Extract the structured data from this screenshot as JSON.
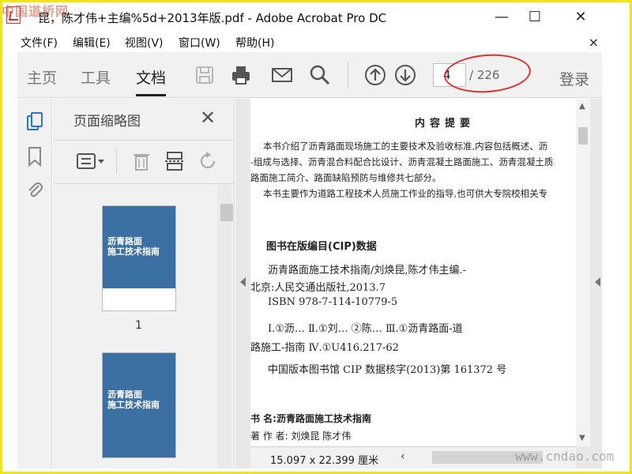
{
  "watermarks": {
    "top": "中国道桥网",
    "bottom": "www.cndao.com"
  },
  "window": {
    "title": "昆，陈才伟+主编%5d+2013年版.pdf - Adobe Acrobat Pro DC",
    "minimize": "—",
    "maximize": "☐",
    "close": "✕"
  },
  "menu": {
    "file": "文件(F)",
    "edit": "编辑(E)",
    "view": "视图(V)",
    "window": "窗口(W)",
    "help": "帮助(H)",
    "close": "×"
  },
  "toolbar": {
    "tabs": {
      "home": "主页",
      "tools": "工具",
      "document": "文档"
    },
    "current_page": "4",
    "total_pages": "/ 226",
    "sign_in": "登录"
  },
  "panel": {
    "title": "页面缩略图",
    "thumbnails": [
      {
        "label": "1",
        "cover_title": "沥青路面\n施工技术指南"
      },
      {
        "cover_title": "沥青路面\n施工技术指南"
      }
    ]
  },
  "page": {
    "heading": "内容提要",
    "paragraph1_line1": "本书介绍了沥青路面现场施工的主要技术及验收标准,内容包括概述、沥",
    "paragraph1_line2": "-组成与选择、沥青混合料配合比设计、沥青混凝土路面施工、沥青混凝土质",
    "paragraph1_line3": "路面施工简介、路面缺陷预防与维修共七部分。",
    "paragraph2": "本书主要作为道路工程技术人员施工作业的指导,也可供大专院校相关专",
    "cip_title": "图书在版编目(CIP)数据",
    "cip_line1": "沥青路面施工技术指南/刘焕昆,陈才伟主编.-",
    "cip_line2": "北京:人民交通出版社,2013.7",
    "cip_line3": "ISBN 978-7-114-10779-5",
    "cip_line4": "Ⅰ.①沥…  Ⅱ.①刘…  ②陈…  Ⅲ.①沥青路面-道",
    "cip_line5": "路施工-指南  Ⅳ.①U416.217-62",
    "cip_line6": "中国版本图书馆 CIP 数据核字(2013)第 161372 号",
    "book_name": "书    名:沥青路面施工技术指南",
    "authors": "著 作 者: 刘焕昆    陈才伟"
  },
  "status": {
    "dimensions": "15.097 x 22.399 厘米"
  },
  "colors": {
    "cover_blue": "#3c6fa2",
    "annotation_red": "#d33333",
    "frame_yellow": "#f0e31a"
  }
}
